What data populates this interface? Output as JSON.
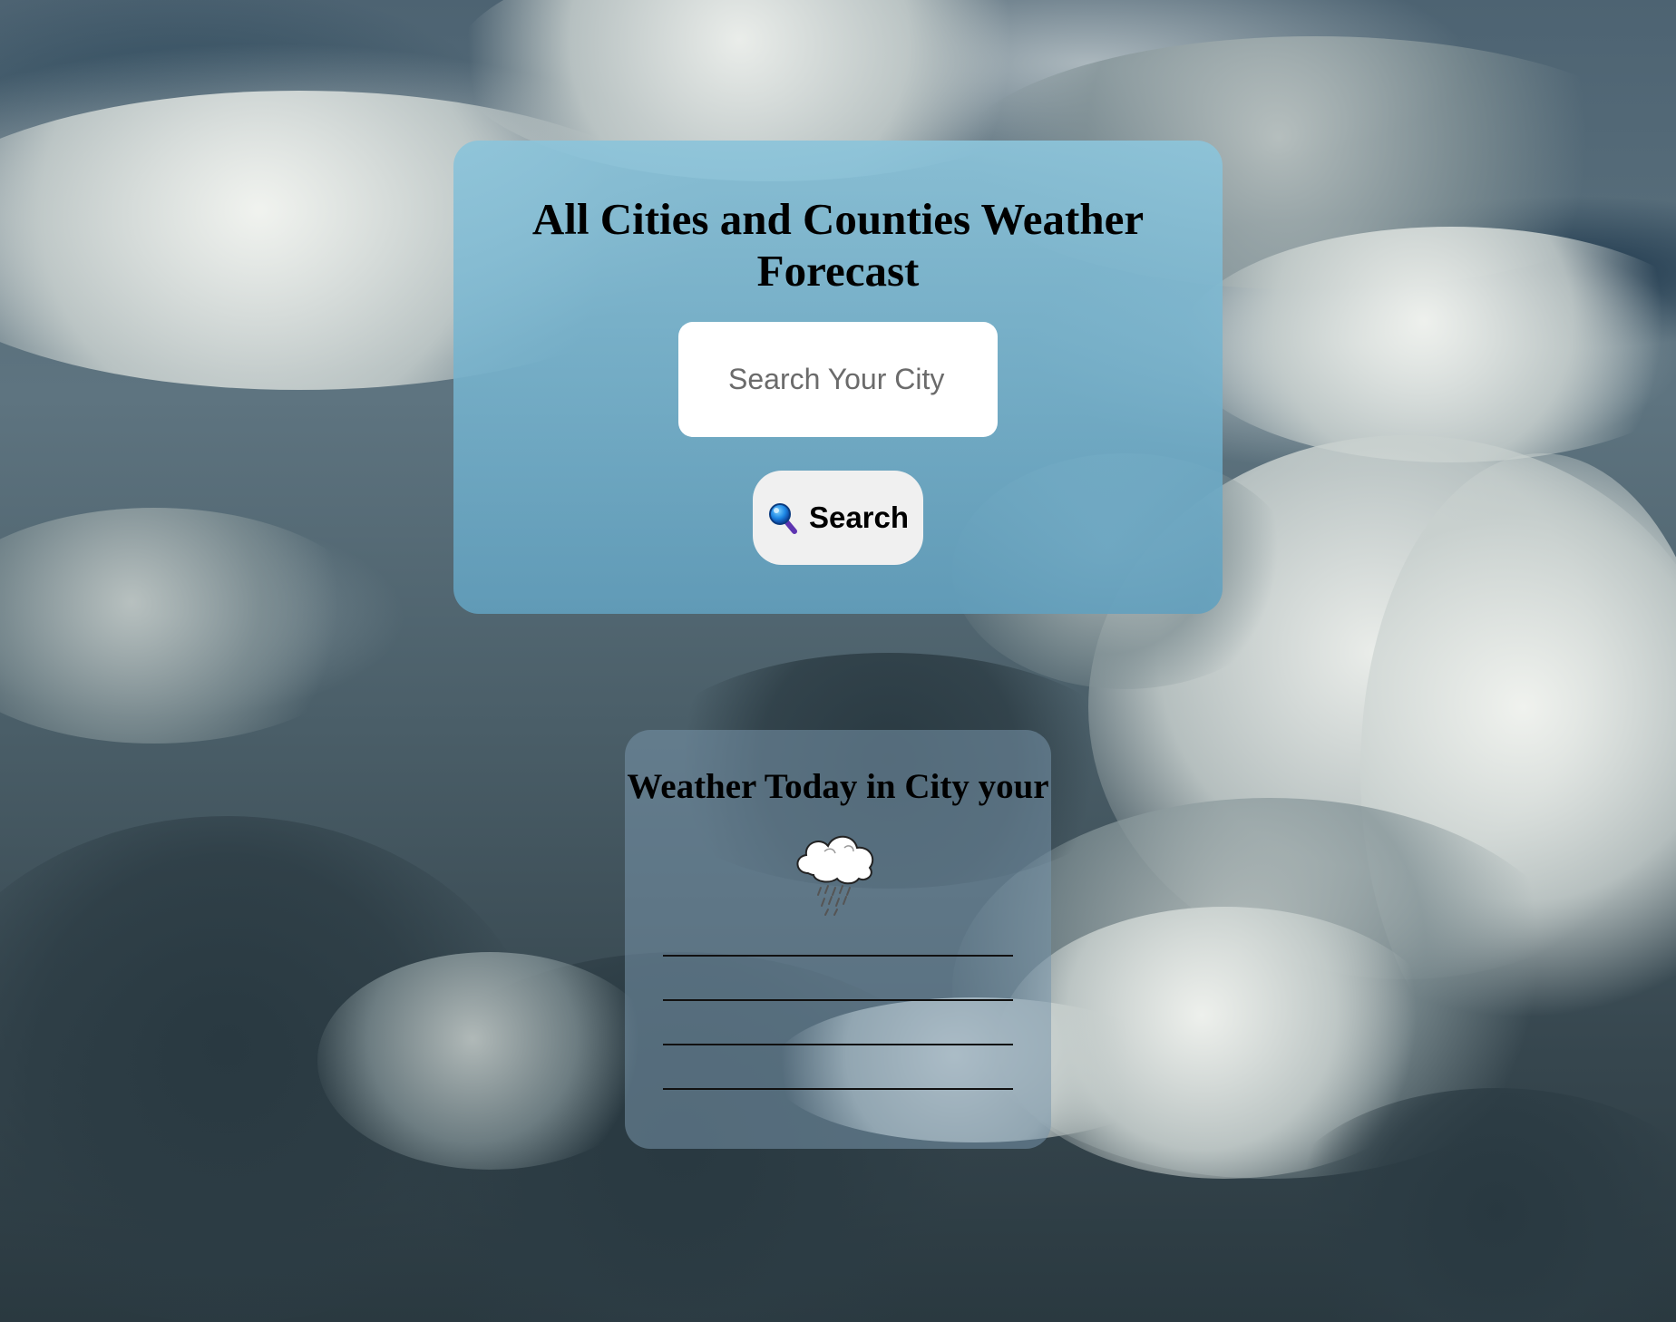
{
  "search": {
    "title": "All Cities and Counties Weather Forecast",
    "placeholder": "Search Your City",
    "button_label": "Search",
    "button_icon": "magnifying-glass-icon"
  },
  "result": {
    "title": "Weather Today in City your",
    "weather_icon": "rain-cloud-icon",
    "lines": [
      "",
      "",
      "",
      ""
    ]
  },
  "colors": {
    "card_top": "#8cc4da",
    "card_bottom": "#62a0be",
    "button_bg": "#f0f0f0",
    "input_bg": "#ffffff"
  }
}
